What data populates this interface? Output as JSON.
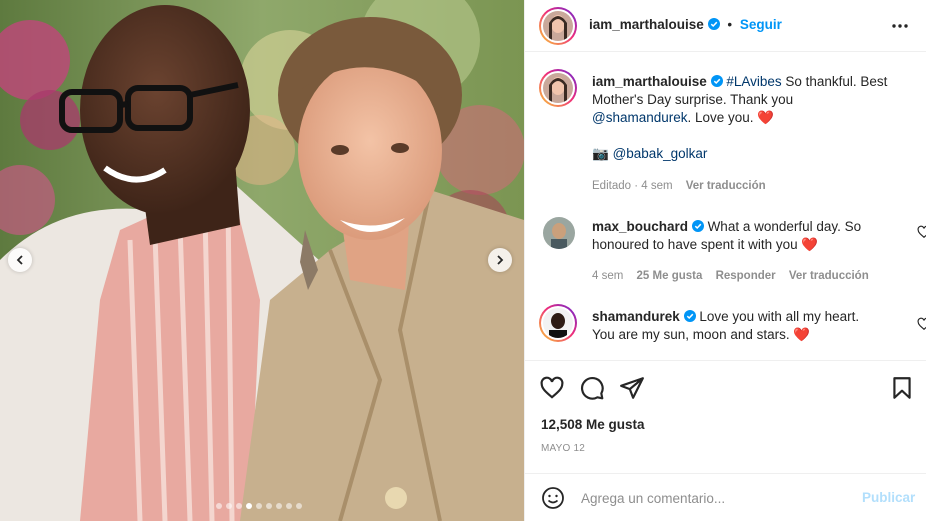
{
  "header": {
    "username": "iam_marthalouise",
    "separator": "•",
    "follow_label": "Seguir",
    "more_icon": "more-horizontal-icon"
  },
  "caption": {
    "username": "iam_marthalouise",
    "hashtag": "#LAvibes",
    "text_1": " So thankful. Best Mother's Day surprise. Thank you ",
    "mention": "@shamandurek",
    "text_2": ". Love you. ",
    "heart": "❤️",
    "camera": "📷",
    "photo_credit": "@babak_golkar",
    "edited": "Editado · 4 sem",
    "translate": "Ver traducción"
  },
  "comments": [
    {
      "username": "max_bouchard",
      "text": " What a wonderful day. So honoured to have spent it with you ",
      "heart": "❤️",
      "time": "4 sem",
      "likes": "25 Me gusta",
      "reply": "Responder",
      "translate": "Ver traducción"
    },
    {
      "username": "shamandurek",
      "text": " Love you with all my heart. You are my sun, moon and stars. ",
      "heart": "❤️"
    }
  ],
  "actions": {
    "like_icon": "heart-outline-icon",
    "comment_icon": "comment-icon",
    "share_icon": "paper-plane-icon",
    "save_icon": "bookmark-icon"
  },
  "likes": "12,508 Me gusta",
  "date": "MAYO 12",
  "composer": {
    "placeholder": "Agrega un comentario...",
    "publish_label": "Publicar"
  },
  "carousel": {
    "total": 9,
    "active_index": 3
  },
  "colors": {
    "accent": "#0095f6",
    "publish_disabled": "#b2dffc",
    "heart": "#ed4956",
    "meta": "#8e8e8e"
  }
}
